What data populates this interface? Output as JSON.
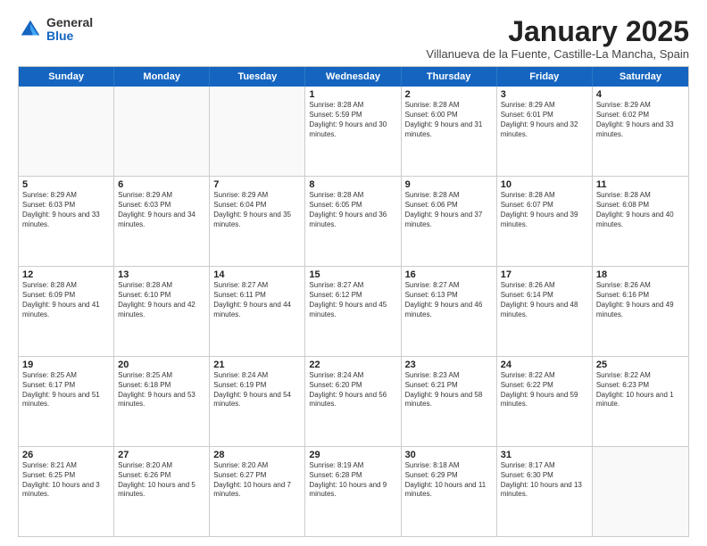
{
  "logo": {
    "general": "General",
    "blue": "Blue"
  },
  "title": "January 2025",
  "subtitle": "Villanueva de la Fuente, Castille-La Mancha, Spain",
  "header_days": [
    "Sunday",
    "Monday",
    "Tuesday",
    "Wednesday",
    "Thursday",
    "Friday",
    "Saturday"
  ],
  "weeks": [
    [
      {
        "day": "",
        "sunrise": "",
        "sunset": "",
        "daylight": ""
      },
      {
        "day": "",
        "sunrise": "",
        "sunset": "",
        "daylight": ""
      },
      {
        "day": "",
        "sunrise": "",
        "sunset": "",
        "daylight": ""
      },
      {
        "day": "1",
        "sunrise": "Sunrise: 8:28 AM",
        "sunset": "Sunset: 5:59 PM",
        "daylight": "Daylight: 9 hours and 30 minutes."
      },
      {
        "day": "2",
        "sunrise": "Sunrise: 8:28 AM",
        "sunset": "Sunset: 6:00 PM",
        "daylight": "Daylight: 9 hours and 31 minutes."
      },
      {
        "day": "3",
        "sunrise": "Sunrise: 8:29 AM",
        "sunset": "Sunset: 6:01 PM",
        "daylight": "Daylight: 9 hours and 32 minutes."
      },
      {
        "day": "4",
        "sunrise": "Sunrise: 8:29 AM",
        "sunset": "Sunset: 6:02 PM",
        "daylight": "Daylight: 9 hours and 33 minutes."
      }
    ],
    [
      {
        "day": "5",
        "sunrise": "Sunrise: 8:29 AM",
        "sunset": "Sunset: 6:03 PM",
        "daylight": "Daylight: 9 hours and 33 minutes."
      },
      {
        "day": "6",
        "sunrise": "Sunrise: 8:29 AM",
        "sunset": "Sunset: 6:03 PM",
        "daylight": "Daylight: 9 hours and 34 minutes."
      },
      {
        "day": "7",
        "sunrise": "Sunrise: 8:29 AM",
        "sunset": "Sunset: 6:04 PM",
        "daylight": "Daylight: 9 hours and 35 minutes."
      },
      {
        "day": "8",
        "sunrise": "Sunrise: 8:28 AM",
        "sunset": "Sunset: 6:05 PM",
        "daylight": "Daylight: 9 hours and 36 minutes."
      },
      {
        "day": "9",
        "sunrise": "Sunrise: 8:28 AM",
        "sunset": "Sunset: 6:06 PM",
        "daylight": "Daylight: 9 hours and 37 minutes."
      },
      {
        "day": "10",
        "sunrise": "Sunrise: 8:28 AM",
        "sunset": "Sunset: 6:07 PM",
        "daylight": "Daylight: 9 hours and 39 minutes."
      },
      {
        "day": "11",
        "sunrise": "Sunrise: 8:28 AM",
        "sunset": "Sunset: 6:08 PM",
        "daylight": "Daylight: 9 hours and 40 minutes."
      }
    ],
    [
      {
        "day": "12",
        "sunrise": "Sunrise: 8:28 AM",
        "sunset": "Sunset: 6:09 PM",
        "daylight": "Daylight: 9 hours and 41 minutes."
      },
      {
        "day": "13",
        "sunrise": "Sunrise: 8:28 AM",
        "sunset": "Sunset: 6:10 PM",
        "daylight": "Daylight: 9 hours and 42 minutes."
      },
      {
        "day": "14",
        "sunrise": "Sunrise: 8:27 AM",
        "sunset": "Sunset: 6:11 PM",
        "daylight": "Daylight: 9 hours and 44 minutes."
      },
      {
        "day": "15",
        "sunrise": "Sunrise: 8:27 AM",
        "sunset": "Sunset: 6:12 PM",
        "daylight": "Daylight: 9 hours and 45 minutes."
      },
      {
        "day": "16",
        "sunrise": "Sunrise: 8:27 AM",
        "sunset": "Sunset: 6:13 PM",
        "daylight": "Daylight: 9 hours and 46 minutes."
      },
      {
        "day": "17",
        "sunrise": "Sunrise: 8:26 AM",
        "sunset": "Sunset: 6:14 PM",
        "daylight": "Daylight: 9 hours and 48 minutes."
      },
      {
        "day": "18",
        "sunrise": "Sunrise: 8:26 AM",
        "sunset": "Sunset: 6:16 PM",
        "daylight": "Daylight: 9 hours and 49 minutes."
      }
    ],
    [
      {
        "day": "19",
        "sunrise": "Sunrise: 8:25 AM",
        "sunset": "Sunset: 6:17 PM",
        "daylight": "Daylight: 9 hours and 51 minutes."
      },
      {
        "day": "20",
        "sunrise": "Sunrise: 8:25 AM",
        "sunset": "Sunset: 6:18 PM",
        "daylight": "Daylight: 9 hours and 53 minutes."
      },
      {
        "day": "21",
        "sunrise": "Sunrise: 8:24 AM",
        "sunset": "Sunset: 6:19 PM",
        "daylight": "Daylight: 9 hours and 54 minutes."
      },
      {
        "day": "22",
        "sunrise": "Sunrise: 8:24 AM",
        "sunset": "Sunset: 6:20 PM",
        "daylight": "Daylight: 9 hours and 56 minutes."
      },
      {
        "day": "23",
        "sunrise": "Sunrise: 8:23 AM",
        "sunset": "Sunset: 6:21 PM",
        "daylight": "Daylight: 9 hours and 58 minutes."
      },
      {
        "day": "24",
        "sunrise": "Sunrise: 8:22 AM",
        "sunset": "Sunset: 6:22 PM",
        "daylight": "Daylight: 9 hours and 59 minutes."
      },
      {
        "day": "25",
        "sunrise": "Sunrise: 8:22 AM",
        "sunset": "Sunset: 6:23 PM",
        "daylight": "Daylight: 10 hours and 1 minute."
      }
    ],
    [
      {
        "day": "26",
        "sunrise": "Sunrise: 8:21 AM",
        "sunset": "Sunset: 6:25 PM",
        "daylight": "Daylight: 10 hours and 3 minutes."
      },
      {
        "day": "27",
        "sunrise": "Sunrise: 8:20 AM",
        "sunset": "Sunset: 6:26 PM",
        "daylight": "Daylight: 10 hours and 5 minutes."
      },
      {
        "day": "28",
        "sunrise": "Sunrise: 8:20 AM",
        "sunset": "Sunset: 6:27 PM",
        "daylight": "Daylight: 10 hours and 7 minutes."
      },
      {
        "day": "29",
        "sunrise": "Sunrise: 8:19 AM",
        "sunset": "Sunset: 6:28 PM",
        "daylight": "Daylight: 10 hours and 9 minutes."
      },
      {
        "day": "30",
        "sunrise": "Sunrise: 8:18 AM",
        "sunset": "Sunset: 6:29 PM",
        "daylight": "Daylight: 10 hours and 11 minutes."
      },
      {
        "day": "31",
        "sunrise": "Sunrise: 8:17 AM",
        "sunset": "Sunset: 6:30 PM",
        "daylight": "Daylight: 10 hours and 13 minutes."
      },
      {
        "day": "",
        "sunrise": "",
        "sunset": "",
        "daylight": ""
      }
    ]
  ]
}
